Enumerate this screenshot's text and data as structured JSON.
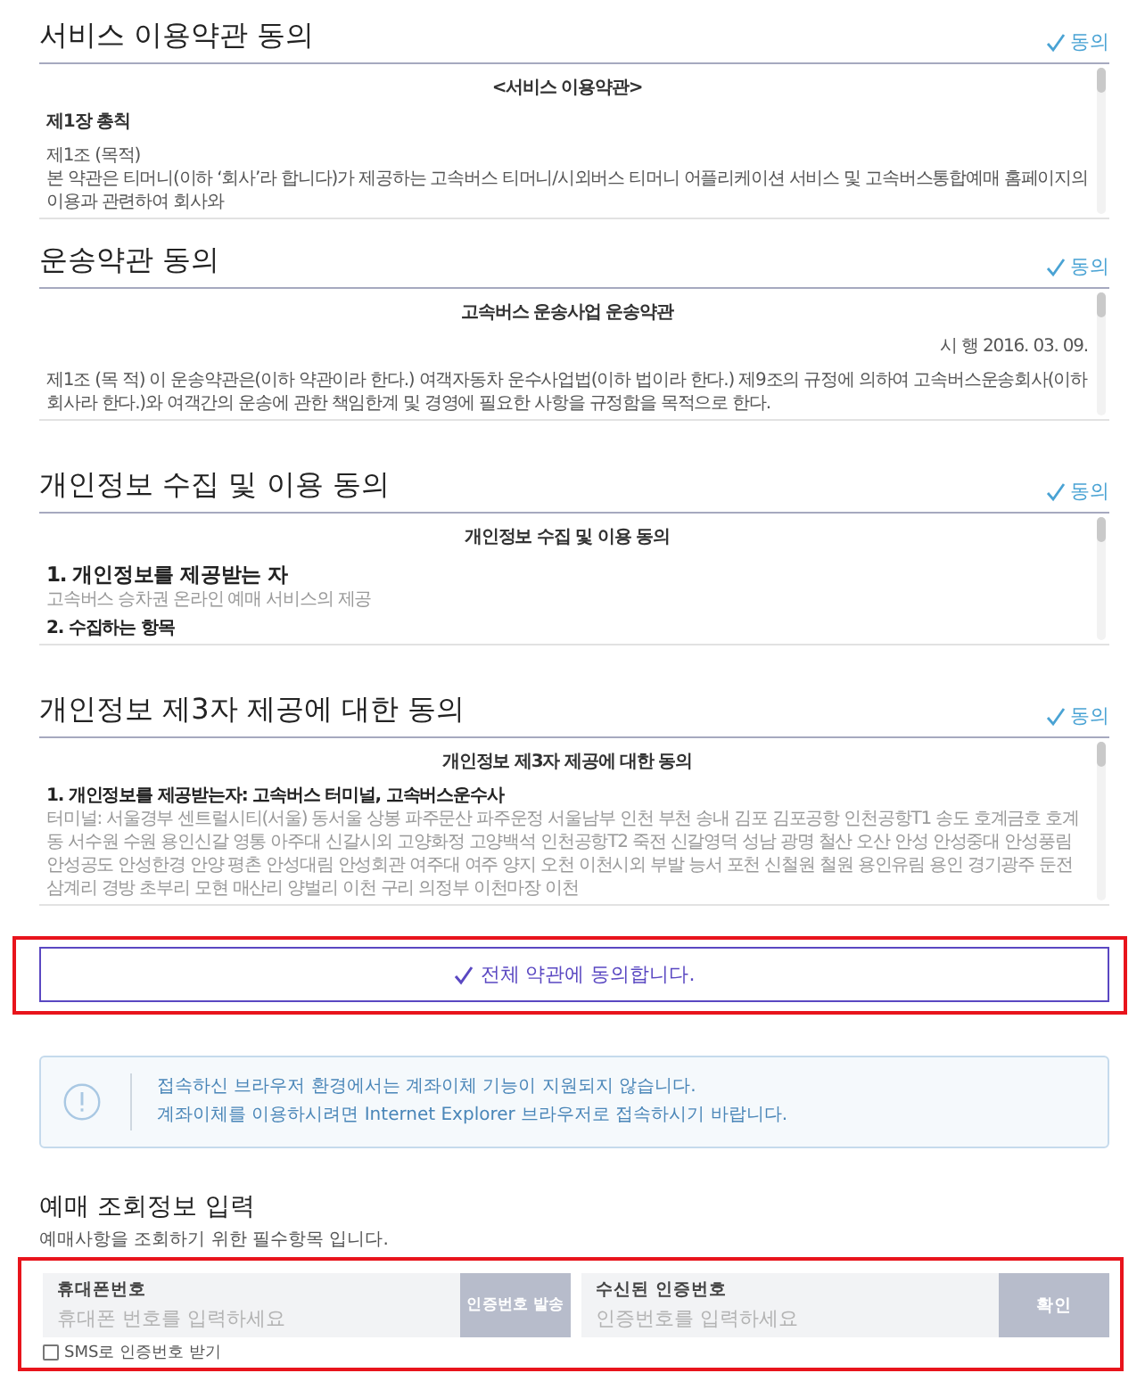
{
  "sections": [
    {
      "title": "서비스 이용약관 동의",
      "agree": {
        "label": "동의",
        "checked": true
      },
      "doc": {
        "heading": "<서비스 이용약관>",
        "blocks": [
          {
            "kind": "chapter",
            "text": "제1장 총칙"
          },
          {
            "kind": "text",
            "text": "제1조 (목적)"
          },
          {
            "kind": "text",
            "text": "본 약관은 티머니(이하 ‘회사’라 합니다)가 제공하는 고속버스 티머니/시외버스 티머니 어플리케이션 서비스 및 고속버스통합예매 홈페이지의 이용과 관련하여 회사와"
          }
        ]
      }
    },
    {
      "title": "운송약관 동의",
      "agree": {
        "label": "동의",
        "checked": true
      },
      "doc": {
        "heading": "고속버스 운송사업 운송약관",
        "blocks": [
          {
            "kind": "date",
            "text": "시 행 2016. 03. 09."
          },
          {
            "kind": "text",
            "text": "제1조 (목 적) 이 운송약관은(이하 약관이라 한다.) 여객자동차 운수사업법(이하 법이라 한다.) 제9조의 규정에 의하여 고속버스운송회사(이하 회사라 한다.)와 여객간의 운송에 관한 책임한계 및 경영에 필요한 사항을 규정함을 목적으로 한다."
          }
        ]
      }
    },
    {
      "title": "개인정보 수집 및 이용 동의",
      "agree": {
        "label": "동의",
        "checked": true
      },
      "doc": {
        "heading": "개인정보 수집 및 이용 동의",
        "blocks": [
          {
            "kind": "h1",
            "text": "1. 개인정보를 제공받는 자"
          },
          {
            "kind": "muted",
            "text": "고속버스 승차권 온라인 예매 서비스의 제공"
          },
          {
            "kind": "h2",
            "text": "2. 수집하는 항목"
          }
        ]
      }
    },
    {
      "title": "개인정보 제3자 제공에 대한 동의",
      "agree": {
        "label": "동의",
        "checked": true
      },
      "doc": {
        "heading": "개인정보 제3자 제공에 대한 동의",
        "blocks": [
          {
            "kind": "h2",
            "text": "1. 개인정보를 제공받는자: 고속버스 터미널, 고속버스운수사"
          },
          {
            "kind": "muted",
            "text": "터미널: 서울경부 센트럴시티(서울) 동서울 상봉 파주문산 파주운정 서울남부 인천 부천 송내 김포 김포공항 인천공항T1 송도 호계금호 호계동 서수원 수원 용인신갈 영통 아주대 신갈시외 고양화정 고양백석 인천공항T2 죽전 신갈영덕 성남 광명 철산 오산 안성 안성중대 안성풍림 안성공도 안성한경 안양 평촌 안성대림 안성회관 여주대 여주 양지 오천 이천시외 부발 능서 포천 신철원 철원 용인유림 용인 경기광주 둔전 삼계리 경방 초부리 모현 매산리 양벌리 이천 구리 의정부 이천마장 이천"
          }
        ]
      }
    }
  ],
  "agree_all": {
    "label": "전체 약관에 동의합니다.",
    "checked": true
  },
  "notice": {
    "lines": [
      "접속하신 브라우저 환경에서는 계좌이체 기능이 지원되지 않습니다.",
      "계좌이체를 이용하시려면 Internet Explorer 브라우저로 접속하시기 바랍니다."
    ]
  },
  "form": {
    "title": "예매 조회정보 입력",
    "subtitle": "예매사항을 조회하기 위한 필수항목 입니다.",
    "fields": [
      {
        "label": "휴대폰번호",
        "placeholder": "휴대폰 번호를 입력하세요",
        "button": "인증번호 발송"
      },
      {
        "label": "수신된 인증번호",
        "placeholder": "인증번호를 입력하세요",
        "button": "확인"
      }
    ],
    "sms": {
      "label": "SMS로 인증번호 받기",
      "checked": false
    }
  }
}
